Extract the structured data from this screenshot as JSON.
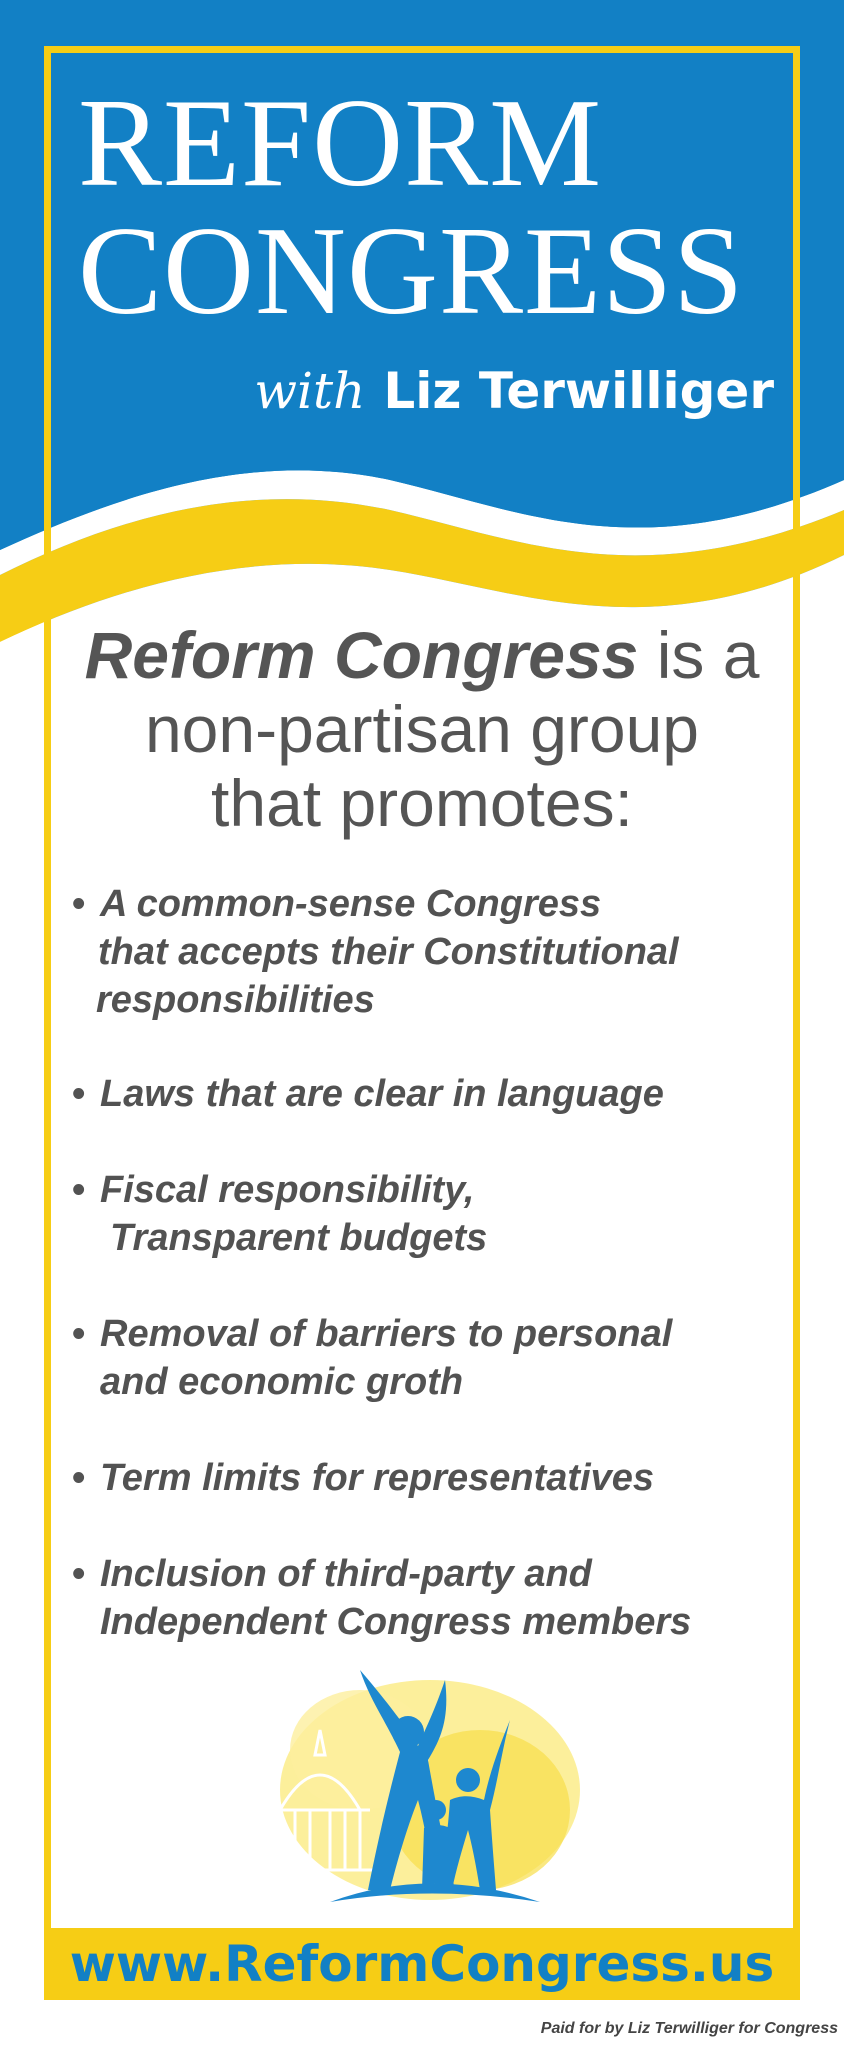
{
  "header": {
    "title_line1": "REFORM",
    "title_line2": "CONGRESS",
    "with": "with",
    "name": "Liz Terwilliger"
  },
  "intro": {
    "emphasis": "Reform Congress",
    "rest_line1": " is a",
    "line2": "non-partisan group",
    "line3": "that promotes:"
  },
  "bullets": [
    {
      "line1": "A common-sense Congress",
      "line2": "that accepts their Constitutional",
      "line3": "responsibilities"
    },
    {
      "line1": "Laws that are clear in language"
    },
    {
      "line1": "Fiscal responsibility,",
      "line2": "Transparent budgets"
    },
    {
      "line1": "Removal of barriers to personal",
      "line2": "and economic groth"
    },
    {
      "line1": "Term limits for representatives"
    },
    {
      "line1": "Inclusion of third-party and",
      "line2": "Independent Congress members"
    }
  ],
  "bullet_symbol": "•",
  "footer": {
    "url": "www.ReformCongress.us",
    "paid_for": "Paid for by Liz Terwilliger for Congress"
  },
  "colors": {
    "blue": "#1280c5",
    "yellow": "#f6cd15",
    "text_gray": "#555555"
  },
  "icons": [
    "capitol-dome-icon",
    "family-figures-icon"
  ]
}
